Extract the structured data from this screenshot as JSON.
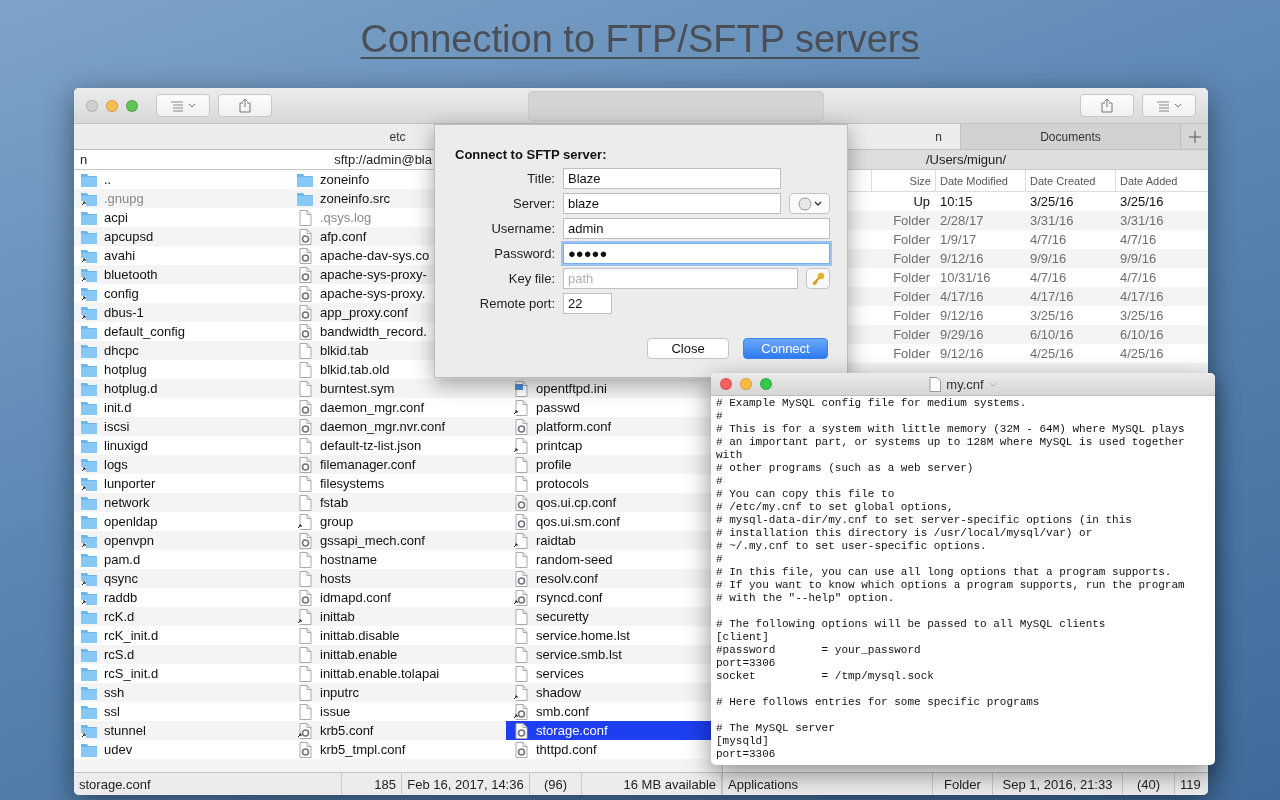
{
  "headline": "Connection to FTP/SFTP servers",
  "main_window": {
    "left_pane": {
      "tab": {
        "label": "etc",
        "selected": true
      },
      "path_prefix": "n",
      "path": "sftp://admin@bla",
      "columns": [
        [
          {
            "name": "..",
            "kind": "folder",
            "hidden": false,
            "selected": false
          },
          {
            "name": ".gnupg",
            "kind": "link-folder",
            "hidden": true,
            "selected": false
          },
          {
            "name": "acpi",
            "kind": "folder",
            "hidden": false,
            "selected": false
          },
          {
            "name": "apcupsd",
            "kind": "folder",
            "hidden": false,
            "selected": false
          },
          {
            "name": "avahi",
            "kind": "link-folder",
            "hidden": false,
            "selected": false
          },
          {
            "name": "bluetooth",
            "kind": "link-folder",
            "hidden": false,
            "selected": false
          },
          {
            "name": "config",
            "kind": "link-folder",
            "hidden": false,
            "selected": false
          },
          {
            "name": "dbus-1",
            "kind": "link-folder",
            "hidden": false,
            "selected": false
          },
          {
            "name": "default_config",
            "kind": "folder",
            "hidden": false,
            "selected": false
          },
          {
            "name": "dhcpc",
            "kind": "folder",
            "hidden": false,
            "selected": false
          },
          {
            "name": "hotplug",
            "kind": "folder",
            "hidden": false,
            "selected": false
          },
          {
            "name": "hotplug.d",
            "kind": "folder",
            "hidden": false,
            "selected": false
          },
          {
            "name": "init.d",
            "kind": "folder",
            "hidden": false,
            "selected": false
          },
          {
            "name": "iscsi",
            "kind": "folder",
            "hidden": false,
            "selected": false
          },
          {
            "name": "linuxigd",
            "kind": "folder",
            "hidden": false,
            "selected": false
          },
          {
            "name": "logs",
            "kind": "link-folder",
            "hidden": false,
            "selected": false
          },
          {
            "name": "lunporter",
            "kind": "link-folder",
            "hidden": false,
            "selected": false
          },
          {
            "name": "network",
            "kind": "folder",
            "hidden": false,
            "selected": false
          },
          {
            "name": "openldap",
            "kind": "folder",
            "hidden": false,
            "selected": false
          },
          {
            "name": "openvpn",
            "kind": "link-folder",
            "hidden": false,
            "selected": false
          },
          {
            "name": "pam.d",
            "kind": "folder",
            "hidden": false,
            "selected": false
          },
          {
            "name": "qsync",
            "kind": "link-folder",
            "hidden": false,
            "selected": false
          },
          {
            "name": "raddb",
            "kind": "link-folder",
            "hidden": false,
            "selected": false
          },
          {
            "name": "rcK.d",
            "kind": "folder",
            "hidden": false,
            "selected": false
          },
          {
            "name": "rcK_init.d",
            "kind": "folder",
            "hidden": false,
            "selected": false
          },
          {
            "name": "rcS.d",
            "kind": "folder",
            "hidden": false,
            "selected": false
          },
          {
            "name": "rcS_init.d",
            "kind": "folder",
            "hidden": false,
            "selected": false
          },
          {
            "name": "ssh",
            "kind": "folder",
            "hidden": false,
            "selected": false
          },
          {
            "name": "ssl",
            "kind": "folder",
            "hidden": false,
            "selected": false
          },
          {
            "name": "stunnel",
            "kind": "link-folder",
            "hidden": false,
            "selected": false
          },
          {
            "name": "udev",
            "kind": "folder",
            "hidden": false,
            "selected": false
          }
        ],
        [
          {
            "name": "zoneinfo",
            "kind": "folder",
            "hidden": false,
            "selected": false
          },
          {
            "name": "zoneinfo.src",
            "kind": "folder",
            "hidden": false,
            "selected": false
          },
          {
            "name": ".qsys.log",
            "kind": "file",
            "hidden": true,
            "selected": false
          },
          {
            "name": "afp.conf",
            "kind": "config",
            "hidden": false,
            "selected": false
          },
          {
            "name": "apache-dav-sys.co",
            "kind": "config",
            "hidden": false,
            "selected": false
          },
          {
            "name": "apache-sys-proxy-",
            "kind": "config",
            "hidden": false,
            "selected": false
          },
          {
            "name": "apache-sys-proxy.",
            "kind": "config",
            "hidden": false,
            "selected": false
          },
          {
            "name": "app_proxy.conf",
            "kind": "config",
            "hidden": false,
            "selected": false
          },
          {
            "name": "bandwidth_record.",
            "kind": "config",
            "hidden": false,
            "selected": false
          },
          {
            "name": "blkid.tab",
            "kind": "file",
            "hidden": false,
            "selected": false
          },
          {
            "name": "blkid.tab.old",
            "kind": "file",
            "hidden": false,
            "selected": false
          },
          {
            "name": "burntest.sym",
            "kind": "file",
            "hidden": false,
            "selected": false
          },
          {
            "name": "daemon_mgr.conf",
            "kind": "config",
            "hidden": false,
            "selected": false
          },
          {
            "name": "daemon_mgr.nvr.conf",
            "kind": "config",
            "hidden": false,
            "selected": false
          },
          {
            "name": "default-tz-list.json",
            "kind": "file",
            "hidden": false,
            "selected": false
          },
          {
            "name": "filemanager.conf",
            "kind": "config",
            "hidden": false,
            "selected": false
          },
          {
            "name": "filesystems",
            "kind": "file",
            "hidden": false,
            "selected": false
          },
          {
            "name": "fstab",
            "kind": "file",
            "hidden": false,
            "selected": false
          },
          {
            "name": "group",
            "kind": "link-file",
            "hidden": false,
            "selected": false
          },
          {
            "name": "gssapi_mech.conf",
            "kind": "config",
            "hidden": false,
            "selected": false
          },
          {
            "name": "hostname",
            "kind": "file",
            "hidden": false,
            "selected": false
          },
          {
            "name": "hosts",
            "kind": "file",
            "hidden": false,
            "selected": false
          },
          {
            "name": "idmapd.conf",
            "kind": "config",
            "hidden": false,
            "selected": false
          },
          {
            "name": "inittab",
            "kind": "link-file",
            "hidden": false,
            "selected": false
          },
          {
            "name": "inittab.disable",
            "kind": "file",
            "hidden": false,
            "selected": false
          },
          {
            "name": "inittab.enable",
            "kind": "file",
            "hidden": false,
            "selected": false
          },
          {
            "name": "inittab.enable.tolapai",
            "kind": "file",
            "hidden": false,
            "selected": false
          },
          {
            "name": "inputrc",
            "kind": "file",
            "hidden": false,
            "selected": false
          },
          {
            "name": "issue",
            "kind": "file",
            "hidden": false,
            "selected": false
          },
          {
            "name": "krb5.conf",
            "kind": "link-config",
            "hidden": false,
            "selected": false
          },
          {
            "name": "krb5_tmpl.conf",
            "kind": "config",
            "hidden": false,
            "selected": false
          }
        ],
        [
          {
            "name": "opentftpd.ini",
            "kind": "ini",
            "hidden": false,
            "selected": false
          },
          {
            "name": "passwd",
            "kind": "link-file",
            "hidden": false,
            "selected": false
          },
          {
            "name": "platform.conf",
            "kind": "config",
            "hidden": false,
            "selected": false
          },
          {
            "name": "printcap",
            "kind": "link-file",
            "hidden": false,
            "selected": false
          },
          {
            "name": "profile",
            "kind": "file",
            "hidden": false,
            "selected": false
          },
          {
            "name": "protocols",
            "kind": "file",
            "hidden": false,
            "selected": false
          },
          {
            "name": "qos.ui.cp.conf",
            "kind": "config",
            "hidden": false,
            "selected": false
          },
          {
            "name": "qos.ui.sm.conf",
            "kind": "config",
            "hidden": false,
            "selected": false
          },
          {
            "name": "raidtab",
            "kind": "link-file",
            "hidden": false,
            "selected": false
          },
          {
            "name": "random-seed",
            "kind": "file",
            "hidden": false,
            "selected": false
          },
          {
            "name": "resolv.conf",
            "kind": "config",
            "hidden": false,
            "selected": false
          },
          {
            "name": "rsyncd.conf",
            "kind": "link-config",
            "hidden": false,
            "selected": false
          },
          {
            "name": "securetty",
            "kind": "file",
            "hidden": false,
            "selected": false
          },
          {
            "name": "service.home.lst",
            "kind": "file",
            "hidden": false,
            "selected": false
          },
          {
            "name": "service.smb.lst",
            "kind": "file",
            "hidden": false,
            "selected": false
          },
          {
            "name": "services",
            "kind": "file",
            "hidden": false,
            "selected": false
          },
          {
            "name": "shadow",
            "kind": "link-file",
            "hidden": false,
            "selected": false
          },
          {
            "name": "smb.conf",
            "kind": "link-config",
            "hidden": false,
            "selected": false
          },
          {
            "name": "storage.conf",
            "kind": "config",
            "hidden": false,
            "selected": true
          },
          {
            "name": "thttpd.conf",
            "kind": "config",
            "hidden": false,
            "selected": false
          }
        ]
      ],
      "status": [
        "storage.conf",
        "185",
        "Feb 16, 2017, 14:36",
        "(96)",
        "16 MB available"
      ]
    },
    "right_pane": {
      "tabs": [
        {
          "label": "n",
          "selected": true
        },
        {
          "label": "Documents",
          "selected": false
        }
      ],
      "path": "/Users/migun/",
      "columns": [
        "Size",
        "Date Modified",
        "Date Created",
        "Date Added"
      ],
      "rows": [
        {
          "cells": [
            "Up",
            "10:15",
            "3/25/16",
            "3/25/16"
          ],
          "dimmed": false
        },
        {
          "cells": [
            "Folder",
            "2/28/17",
            "3/31/16",
            "3/31/16"
          ],
          "dimmed": true
        },
        {
          "cells": [
            "Folder",
            "1/9/17",
            "4/7/16",
            "4/7/16"
          ],
          "dimmed": true
        },
        {
          "cells": [
            "Folder",
            "9/12/16",
            "9/9/16",
            "9/9/16"
          ],
          "dimmed": true
        },
        {
          "cells": [
            "Folder",
            "10/31/16",
            "4/7/16",
            "4/7/16"
          ],
          "dimmed": true
        },
        {
          "cells": [
            "Folder",
            "4/17/16",
            "4/17/16",
            "4/17/16"
          ],
          "dimmed": true
        },
        {
          "cells": [
            "Folder",
            "9/12/16",
            "3/25/16",
            "3/25/16"
          ],
          "dimmed": true
        },
        {
          "cells": [
            "Folder",
            "9/29/16",
            "6/10/16",
            "6/10/16"
          ],
          "dimmed": true
        },
        {
          "cells": [
            "Folder",
            "9/12/16",
            "4/25/16",
            "4/25/16"
          ],
          "dimmed": true
        }
      ],
      "status": [
        "Applications",
        "Folder",
        "Sep 1, 2016, 21:33",
        "(40)",
        "119"
      ]
    }
  },
  "dialog": {
    "title": "Connect to SFTP server:",
    "fields": [
      {
        "label": "Title:",
        "value": "Blaze",
        "focused": false,
        "kind": "title"
      },
      {
        "label": "Server:",
        "value": "blaze",
        "focused": false,
        "kind": "server"
      },
      {
        "label": "Username:",
        "value": "admin",
        "focused": false,
        "kind": "text"
      },
      {
        "label": "Password:",
        "value": "●●●●●",
        "focused": true,
        "kind": "text"
      },
      {
        "label": "Key file:",
        "placeholder": "path",
        "focused": false,
        "kind": "key-file"
      },
      {
        "label": "Remote port:",
        "value": "22",
        "focused": false,
        "kind": "port"
      }
    ],
    "buttons": [
      {
        "label": "Close",
        "default": false
      },
      {
        "label": "Connect",
        "default": true
      }
    ]
  },
  "editor": {
    "title": "my.cnf",
    "text": "# Example MySQL config file for medium systems.\n#\n# This is for a system with little memory (32M - 64M) where MySQL plays\n# an important part, or systems up to 128M where MySQL is used together\nwith\n# other programs (such as a web server)\n#\n# You can copy this file to\n# /etc/my.cnf to set global options,\n# mysql-data-dir/my.cnf to set server-specific options (in this\n# installation this directory is /usr/local/mysql/var) or\n# ~/.my.cnf to set user-specific options.\n#\n# In this file, you can use all long options that a program supports.\n# If you want to know which options a program supports, run the program\n# with the \"--help\" option.\n\n# The following options will be passed to all MySQL clients\n[client]\n#password       = your_password\nport=3306\nsocket          = /tmp/mysql.sock\n\n# Here follows entries for some specific programs\n\n# The MySQL server\n[mysqld]\nport=3306"
  }
}
